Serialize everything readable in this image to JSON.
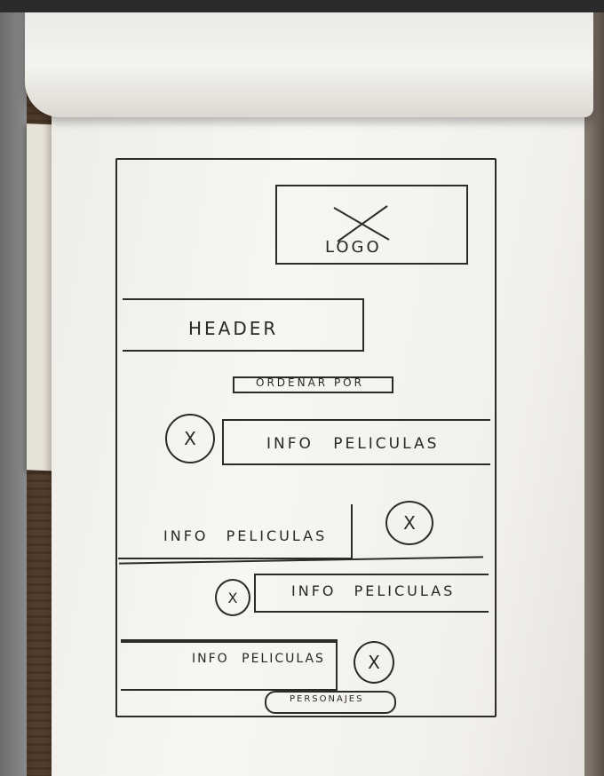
{
  "sketch": {
    "logo": "LOGO",
    "header": "HEADER",
    "sort_button": "ORDENAR POR",
    "movie_label": "INFO PELICULAS",
    "placeholder_mark": "X",
    "footer_button": "PERSONAJES"
  }
}
